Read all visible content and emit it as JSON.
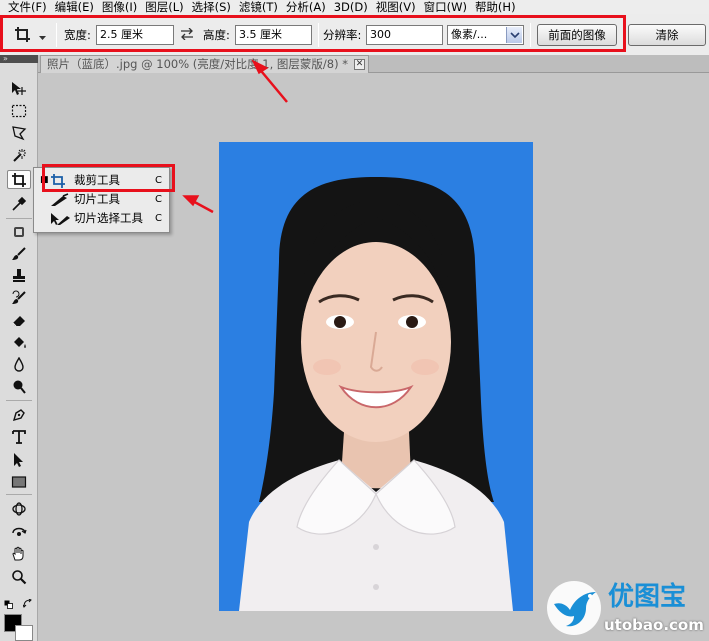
{
  "menu": [
    {
      "label": "文件(F)"
    },
    {
      "label": "编辑(E)"
    },
    {
      "label": "图像(I)"
    },
    {
      "label": "图层(L)"
    },
    {
      "label": "选择(S)"
    },
    {
      "label": "滤镜(T)"
    },
    {
      "label": "分析(A)"
    },
    {
      "label": "3D(D)"
    },
    {
      "label": "视图(V)"
    },
    {
      "label": "窗口(W)"
    },
    {
      "label": "帮助(H)"
    }
  ],
  "options": {
    "width_label": "宽度:",
    "width_value": "2.5 厘米",
    "height_label": "高度:",
    "height_value": "3.5 厘米",
    "resolution_label": "分辨率:",
    "resolution_value": "300",
    "unit_value": "像素/...",
    "front_image_button": "前面的图像",
    "clear_button": "清除"
  },
  "document": {
    "tab_title": "照片（蓝底）.jpg @ 100% (亮度/对比度 1, 图层蒙版/8) *",
    "close_glyph": "✕",
    "photo_background": "#2b7fe2"
  },
  "flyout": {
    "items": [
      {
        "label": "裁剪工具",
        "shortcut": "C",
        "icon": "crop-icon",
        "selected": true
      },
      {
        "label": "切片工具",
        "shortcut": "C",
        "icon": "slice-icon",
        "selected": false
      },
      {
        "label": "切片选择工具",
        "shortcut": "C",
        "icon": "slice-select-icon",
        "selected": false
      }
    ]
  },
  "toolbox": {
    "collapse_glyph": "»"
  },
  "watermark": {
    "brand": "优图宝",
    "domain": "utobao.com"
  },
  "colors": {
    "highlight_red": "#e8101c",
    "photo_blue": "#2b7fe2",
    "watermark_blue": "#1a8fd6"
  }
}
